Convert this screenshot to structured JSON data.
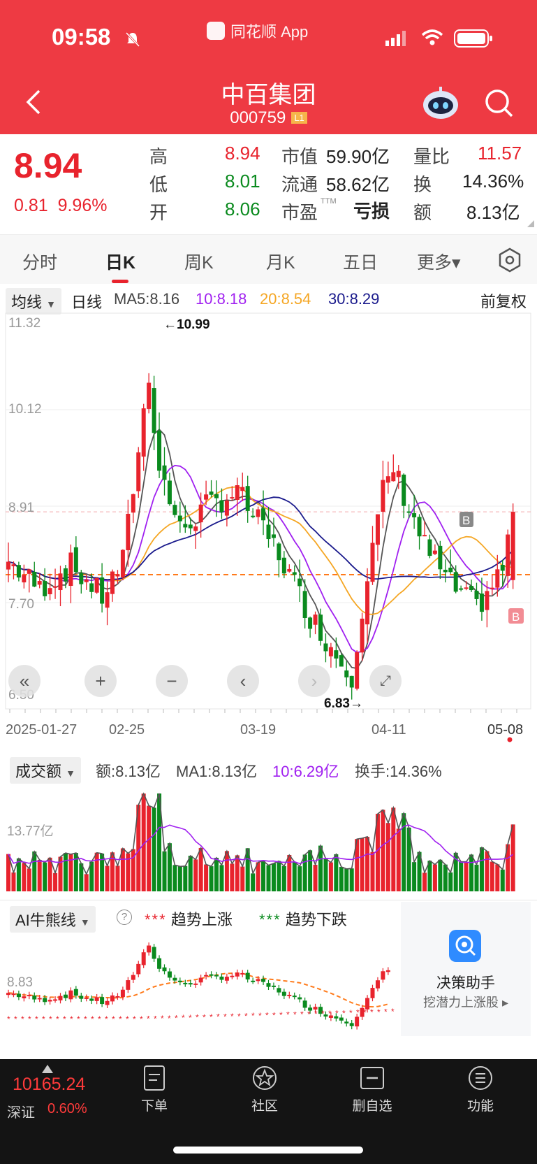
{
  "status_bar": {
    "time": "09:58",
    "app_name": "同花顺 App"
  },
  "header": {
    "title": "中百集团",
    "code": "000759",
    "badge": "L1"
  },
  "quote": {
    "price": "8.94",
    "change": "0.81",
    "change_pct": "9.96%",
    "high_label": "高",
    "high": "8.94",
    "low_label": "低",
    "low": "8.01",
    "open_label": "开",
    "open": "8.06",
    "mcap_label": "市值",
    "mcap": "59.90亿",
    "float_label": "流通",
    "float_cap": "58.62亿",
    "pe_label": "市盈",
    "pe_sup": "TTM",
    "pe": "亏损",
    "vr_label": "量比",
    "vr": "11.57",
    "turnover_label": "换",
    "turnover": "14.36%",
    "amount_label": "额",
    "amount": "8.13亿"
  },
  "tabs": [
    "分时",
    "日K",
    "周K",
    "月K",
    "五日",
    "更多▾"
  ],
  "ma_row": {
    "selector": "均线",
    "period": "日线",
    "ma5": "MA5:8.16",
    "ma10": "10:8.18",
    "ma20": "20:8.54",
    "ma30": "30:8.29",
    "adjust": "前复权"
  },
  "kline": {
    "y_labels": [
      "11.32",
      "10.12",
      "8.91",
      "7.70",
      "6.50"
    ],
    "max_label": "←10.99",
    "min_label": "6.83→",
    "date_labels": [
      "2025-01-27",
      "02-25",
      "03-19",
      "04-11",
      "05-08"
    ],
    "signal_labels": [
      "B",
      "B"
    ]
  },
  "volume": {
    "selector": "成交额",
    "amount": "额:8.13亿",
    "ma1": "MA1:8.13亿",
    "ma10": "10:6.29亿",
    "turnover": "换手:14.36%",
    "y_label": "13.77亿"
  },
  "ai": {
    "selector": "AI牛熊线",
    "help": "?",
    "up_legend": "趋势上涨",
    "down_legend": "趋势下跌",
    "y_label": "8.83",
    "legend_mark": "***"
  },
  "decision": {
    "title": "决策助手",
    "subtitle": "挖潜力上涨股 ▸"
  },
  "bottom_nav": {
    "index_value": "10165.24",
    "index_name": "深证",
    "index_pct": "0.60%",
    "items": [
      "下单",
      "社区",
      "删自选",
      "功能"
    ]
  },
  "colors": {
    "brand": "#ee3a43",
    "up": "#e8232d",
    "down": "#0a8a1e",
    "ma5": "#555555",
    "ma10": "#a020f0",
    "ma20": "#f5a623",
    "ma30": "#1a1a8c"
  }
}
